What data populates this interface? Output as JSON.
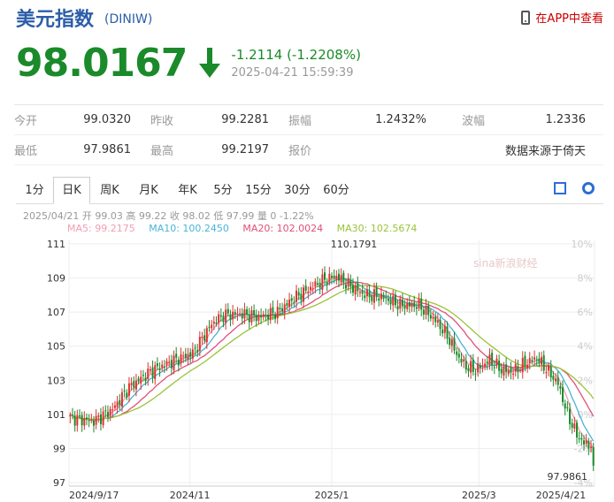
{
  "header": {
    "title": "美元指数",
    "code": "(DINIW)",
    "app_link": "在APP中查看"
  },
  "quote": {
    "price": "98.0167",
    "change": "-1.2114 (-1.2208%)",
    "datetime": "2025-04-21 15:59:39",
    "colors": {
      "down": "#1a8a2a",
      "up": "#e03030"
    }
  },
  "stats": {
    "row1": [
      {
        "label": "今开",
        "value": "99.0320"
      },
      {
        "label": "昨收",
        "value": "99.2281"
      },
      {
        "label": "振幅",
        "value": "1.2432%"
      },
      {
        "label": "波幅",
        "value": "1.2336"
      }
    ],
    "row2": [
      {
        "label": "最低",
        "value": "97.9861"
      },
      {
        "label": "最高",
        "value": "99.2197"
      },
      {
        "label": "报价",
        "value": ""
      },
      {
        "label": "",
        "value": "数据来源于倚天"
      }
    ]
  },
  "tabs": [
    "1分",
    "日K",
    "周K",
    "月K",
    "年K",
    "5分",
    "15分",
    "30分",
    "60分"
  ],
  "active_tab": 1,
  "kline_info": "2025/04/21 开 99.03 高 99.22 收 98.02 低 97.99 量 0 -1.22%",
  "ma_legend": [
    {
      "label": "MA5: 99.2175",
      "color": "#f29db4"
    },
    {
      "label": "MA10: 100.2450",
      "color": "#4ab3d8"
    },
    {
      "label": "MA20: 102.0024",
      "color": "#e0507a"
    },
    {
      "label": "MA30: 102.5674",
      "color": "#9ac33a"
    }
  ],
  "watermark": "sina新浪财经",
  "chart_data": {
    "type": "candlestick",
    "y_ticks": [
      "111",
      "109",
      "107",
      "105",
      "103",
      "101",
      "99",
      "97"
    ],
    "y_right_ticks": [
      "10%",
      "8%",
      "6%",
      "4%",
      "2%",
      "0%",
      "-2%",
      "-4%"
    ],
    "x_ticks": [
      "2024/9/17",
      "2024/11",
      "2025/1",
      "2025/3",
      "2025/4/21"
    ],
    "ylim": [
      96.8,
      111.2
    ],
    "max_label": "110.1791",
    "min_label": "97.9861",
    "grid": true,
    "close_anchors": [
      [
        0,
        100.8
      ],
      [
        10,
        100.6
      ],
      [
        18,
        101.3
      ],
      [
        25,
        102.6
      ],
      [
        35,
        103.6
      ],
      [
        45,
        104.2
      ],
      [
        52,
        104.6
      ],
      [
        60,
        106.3
      ],
      [
        65,
        106.8
      ],
      [
        72,
        106.9
      ],
      [
        80,
        106.7
      ],
      [
        88,
        107.0
      ],
      [
        95,
        107.8
      ],
      [
        103,
        108.5
      ],
      [
        108,
        108.9
      ],
      [
        113,
        109.1
      ],
      [
        118,
        108.6
      ],
      [
        125,
        108.0
      ],
      [
        132,
        107.9
      ],
      [
        140,
        107.4
      ],
      [
        148,
        107.4
      ],
      [
        155,
        106.5
      ],
      [
        160,
        105.6
      ],
      [
        165,
        104.3
      ],
      [
        168,
        103.8
      ],
      [
        172,
        103.6
      ],
      [
        178,
        104.2
      ],
      [
        183,
        103.6
      ],
      [
        188,
        103.5
      ],
      [
        193,
        104.0
      ],
      [
        198,
        104.3
      ],
      [
        203,
        103.5
      ],
      [
        207,
        102.8
      ],
      [
        211,
        101.0
      ],
      [
        215,
        99.8
      ],
      [
        218,
        99.3
      ],
      [
        221,
        99.2
      ],
      [
        222,
        98.0
      ]
    ]
  }
}
